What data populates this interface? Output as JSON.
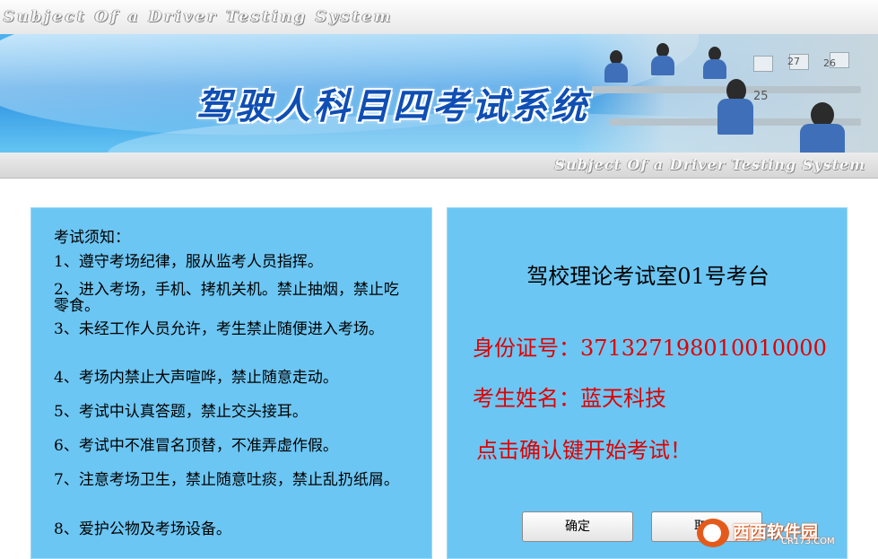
{
  "header": {
    "subtitle_top": "Subject Of a Driver Testing System",
    "title": "驾驶人科目四考试系统",
    "subtitle_bottom": "Subject Of a Driver Testing System",
    "seat_numbers": [
      "27",
      "26",
      "25"
    ]
  },
  "rules": {
    "heading": "考试须知：",
    "items": [
      "1、遵守考场纪律，服从监考人员指挥。",
      "2、进入考场，手机、拷机关机。禁止抽烟，禁止吃零食。",
      "3、未经工作人员允许，考生禁止随便进入考场。",
      "4、考场内禁止大声喧哗，禁止随意走动。",
      "5、考试中认真答题，禁止交头接耳。",
      "6、考试中不准冒名顶替，不准弄虚作假。",
      "7、注意考场卫生，禁止随意吐痰，禁止乱扔纸屑。",
      "8、爱护公物及考场设备。"
    ]
  },
  "info": {
    "station": "驾校理论考试室01号考台",
    "id_line": "身份证号：371327198010010000",
    "name_line": "考生姓名：蓝天科技",
    "prompt": "点击确认键开始考试！"
  },
  "buttons": {
    "ok": "确定",
    "cancel": "取消"
  },
  "watermark": {
    "brand": "西西软件园",
    "site": "CR173.COM"
  },
  "colors": {
    "panel": "#6cc6f3",
    "red_text": "#e00000",
    "title_blue": "#0f4fb4"
  }
}
